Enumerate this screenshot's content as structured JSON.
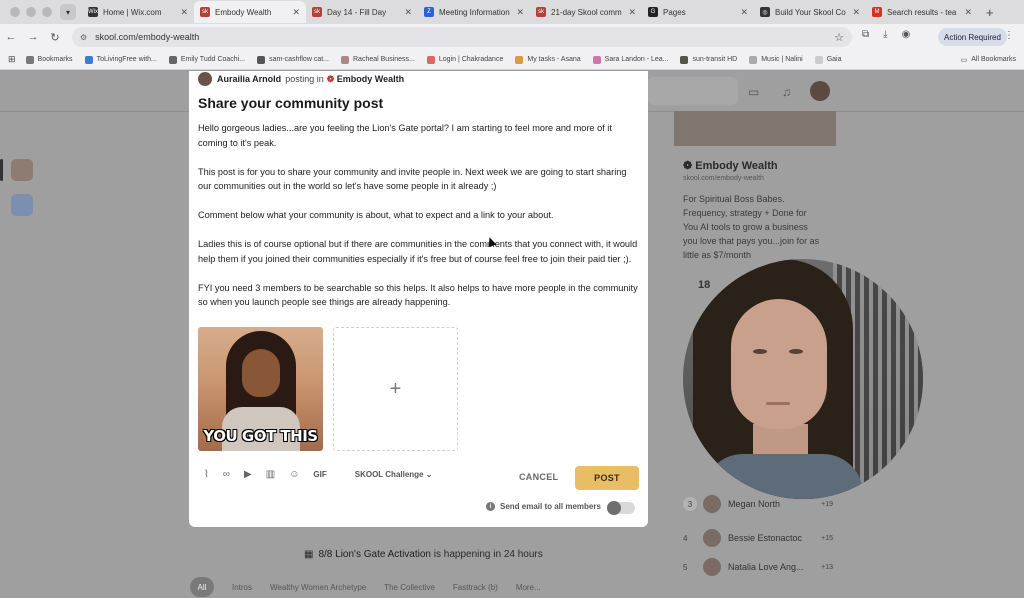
{
  "browser": {
    "tabs": [
      {
        "label": "Home | Wix.com",
        "fav_color": "#333333",
        "fav_text": "Wix"
      },
      {
        "label": "Embody Wealth",
        "fav_color": "#b5403b",
        "fav_text": "sk",
        "active": true
      },
      {
        "label": "Day 14 - Fill Day",
        "fav_color": "#b5403b",
        "fav_text": "sk"
      },
      {
        "label": "Meeting Information",
        "fav_color": "#2b62d9",
        "fav_text": "Z"
      },
      {
        "label": "21-day Skool comm",
        "fav_color": "#b5403b",
        "fav_text": "sk"
      },
      {
        "label": "Pages",
        "fav_color": "#222222",
        "fav_text": "G"
      },
      {
        "label": "Build Your Skool Co",
        "fav_color": "#333333",
        "fav_text": "◎"
      },
      {
        "label": "Search results - tea",
        "fav_color": "#d93025",
        "fav_text": "M"
      }
    ],
    "url": "skool.com/embody-wealth",
    "action_required": "Action Required",
    "bookmarks": [
      "Bookmarks",
      "ToLivingFree with...",
      "Emily Tudd Coachi...",
      "sam-cashflow cat...",
      "Racheal Business...",
      "Login | Chakradance",
      "My tasks - Asana",
      "Sara Landon - Lea...",
      "sun-transit HD",
      "Music | Nalini",
      "Gaia"
    ],
    "all_bookmarks": "All Bookmarks"
  },
  "modal": {
    "author": "Aurailia Arnold",
    "posting_in": "posting in",
    "group": "Embody Wealth",
    "title": "Share your community post",
    "paragraphs": [
      "Hello gorgeous ladies...are you feeling the Lion's Gate portal? I am starting to feel more and more of it coming to it's peak.",
      "This post is for you to share your community and invite people in. Next week we are going to start sharing our communities out in the world so let's have some people in it already ;)",
      "Comment below what your community is about, what to expect and a link to your about.",
      "Ladies this is of course optional but if there are communities in the comments that you connect with, it would help them if you joined their communities especially if it's free but of course feel free to join their paid tier ;).",
      "FYI you need 3 members to be searchable so this helps. It also helps to have more people in the community so when you launch people see things are already happening."
    ],
    "gif_caption": "YOU GOT THIS",
    "add_symbol": "+",
    "toolbar": {
      "gif": "GIF",
      "category": "SKOOL Challenge"
    },
    "cancel_label": "CANCEL",
    "post_label": "POST",
    "email_label": "Send email to all members",
    "email_toggle_on": false
  },
  "background": {
    "community_title": "Embody Wealth",
    "community_url": "skool.com/embody-wealth",
    "description": "For Spiritual Boss Babes. Frequency, strategy + Done for You AI tools to grow a business you love that pays you...join for as little as $7/month",
    "stat": "18",
    "leaderboard": [
      {
        "rank": "3",
        "name": "Megan North",
        "points": "+19"
      },
      {
        "rank": "4",
        "name": "Bessie Estonactoc",
        "points": "+15"
      },
      {
        "rank": "5",
        "name": "Natalia Love Ang...",
        "points": "+13"
      }
    ],
    "event": {
      "name": "8/8 Lion's Gate Activation",
      "suffix": "is happening in 24 hours"
    },
    "filters": [
      "All",
      "Intros",
      "Wealthy Women Archetype",
      "The Collective",
      "Fasttrack (b)",
      "More..."
    ]
  }
}
